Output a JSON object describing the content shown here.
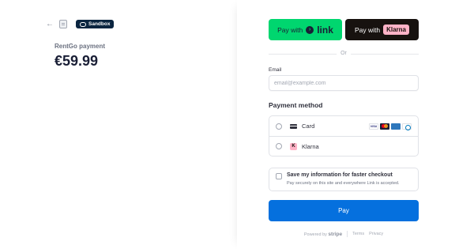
{
  "header": {
    "badge_label": "Sandbox",
    "back_icon": "arrow-left-icon",
    "store_icon": "store-icon"
  },
  "summary": {
    "merchant_label": "RentGo payment",
    "amount": "€59.99"
  },
  "wallets": {
    "link_prefix": "Pay with",
    "link_brand": "link",
    "klarna_prefix": "Pay with",
    "klarna_brand": "Klarna"
  },
  "divider_label": "Or",
  "email": {
    "label": "Email",
    "placeholder": "email@example.com",
    "value": ""
  },
  "payment_method": {
    "title": "Payment method",
    "options": [
      {
        "label": "Card",
        "icon": "credit-card-icon",
        "brands": [
          "VISA",
          "MC",
          "AMEX",
          "Diners"
        ]
      },
      {
        "label": "Klarna",
        "icon": "klarna-icon",
        "icon_letter": "K"
      }
    ]
  },
  "save_info": {
    "title": "Save my information for faster checkout",
    "subtitle": "Pay securely on this site and everywhere Link is accepted."
  },
  "pay_button_label": "Pay",
  "footer": {
    "powered_by": "Powered by",
    "brand": "stripe",
    "terms": "Terms",
    "privacy": "Privacy"
  },
  "colors": {
    "link_green": "#00d66f",
    "klarna_black": "#17120f",
    "klarna_pink": "#ffb3c7",
    "pay_blue": "#0570de",
    "sandbox_navy": "#0a2540"
  }
}
